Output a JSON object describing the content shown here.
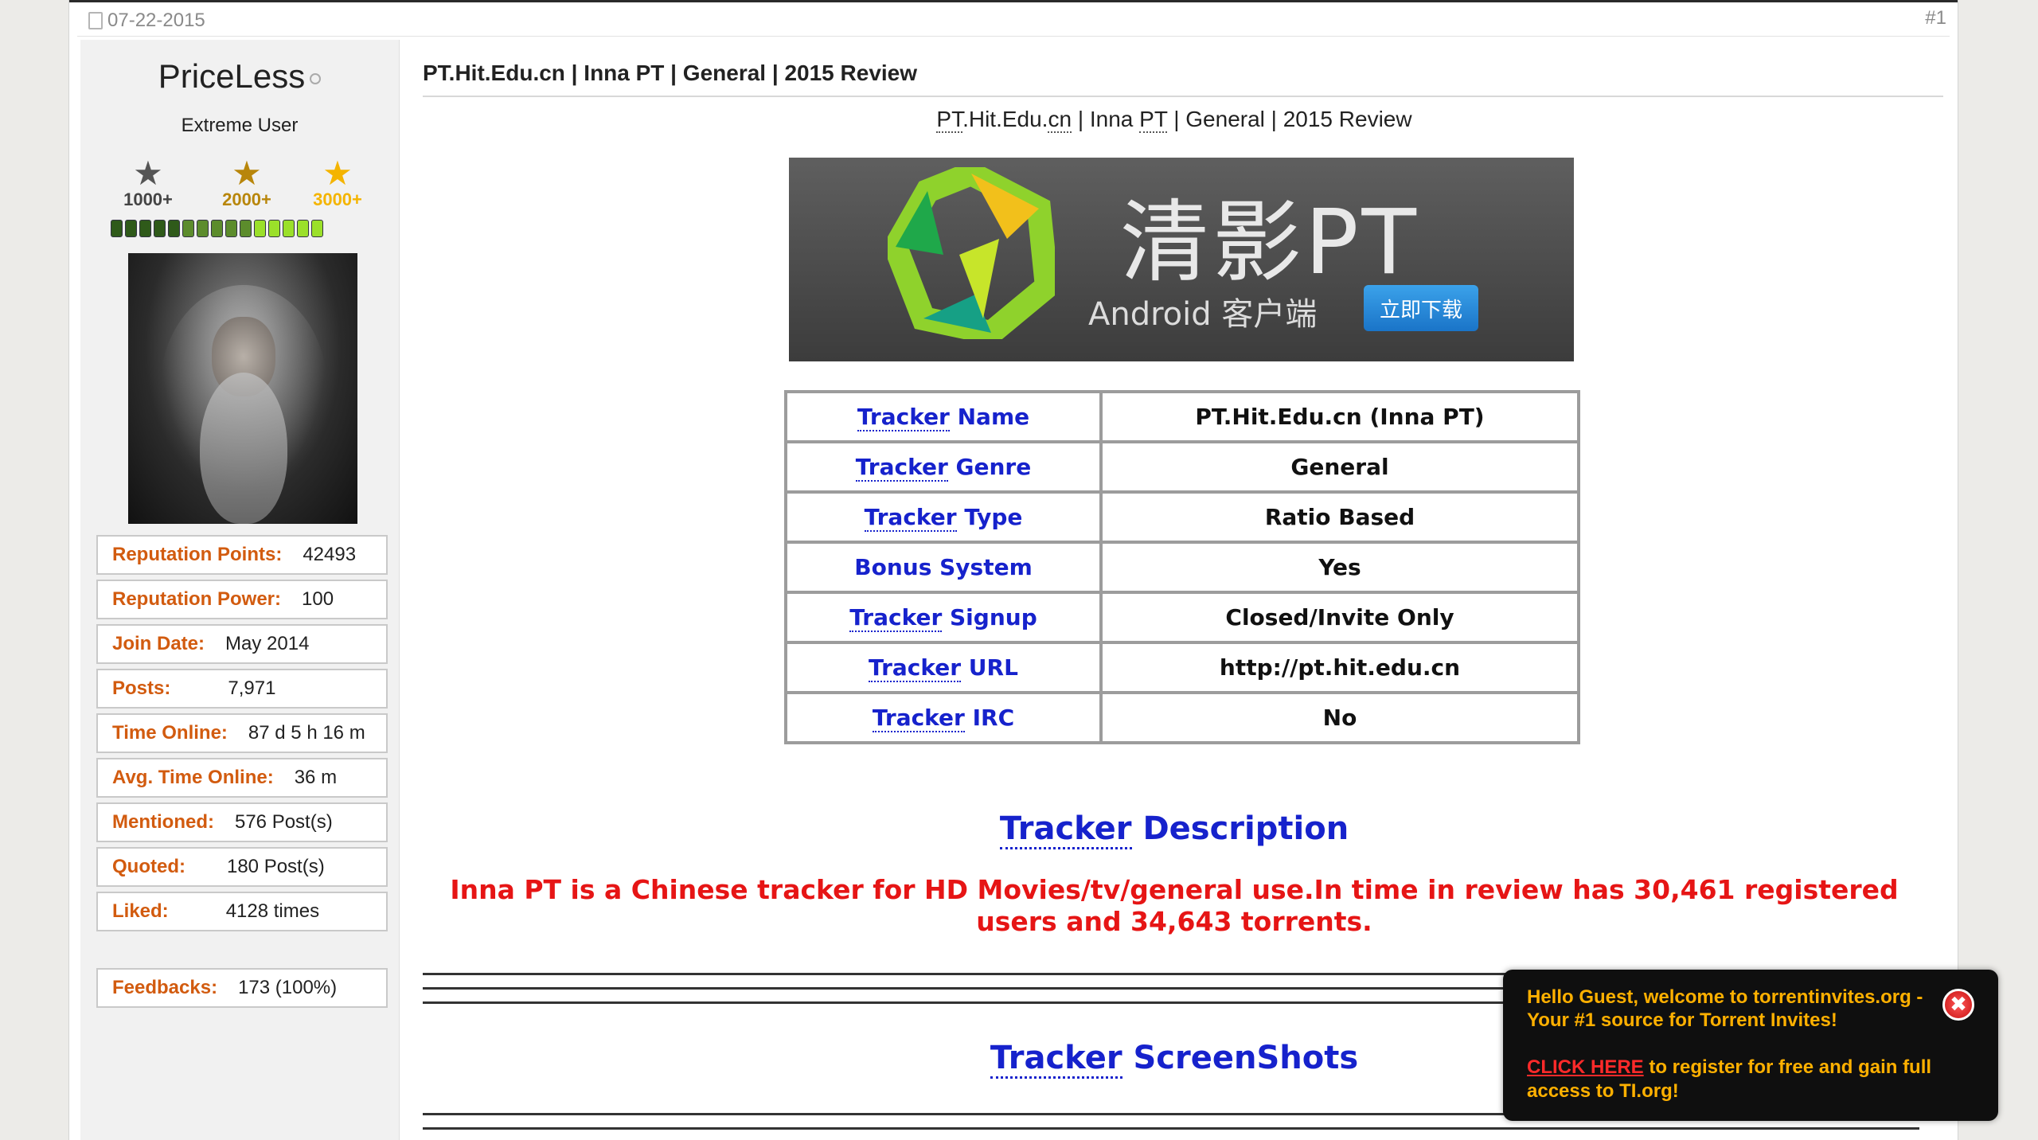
{
  "post": {
    "date": "07-22-2015",
    "number": "#1"
  },
  "user": {
    "name": "PriceLess",
    "title": "Extreme User",
    "awards": [
      {
        "label": "1000+",
        "color": "#555555"
      },
      {
        "label": "2000+",
        "color": "#b8860b"
      },
      {
        "label": "3000+",
        "color": "#f4b400"
      }
    ],
    "rep_segments": [
      "#2f5a1a",
      "#2f5a1a",
      "#2f5a1a",
      "#2f5a1a",
      "#2f5a1a",
      "#5c8c2c",
      "#5c8c2c",
      "#5c8c2c",
      "#5c8c2c",
      "#5c8c2c",
      "#9be02a",
      "#9be02a",
      "#9be02a",
      "#9be02a",
      "#9be02a"
    ],
    "stats": [
      {
        "label": "Reputation Points:",
        "value": "42493"
      },
      {
        "label": "Reputation Power:",
        "value": "100"
      },
      {
        "label": "Join Date:",
        "value": "May 2014"
      },
      {
        "label": "Posts:",
        "value": "7,971"
      },
      {
        "label": "Time Online:",
        "value": "87 d 5 h 16 m"
      },
      {
        "label": "Avg. Time Online:",
        "value": "36 m"
      },
      {
        "label": "Mentioned:",
        "value": "576 Post(s)"
      },
      {
        "label": "Quoted:",
        "value": "180 Post(s)"
      },
      {
        "label": "Liked:",
        "value": "4128 times"
      }
    ],
    "feedback": {
      "label": "Feedbacks:",
      "value": "173 (100%)"
    }
  },
  "content": {
    "title": "PT.Hit.Edu.cn | Inna PT | General | 2015 Review",
    "subtitle": {
      "a": "PT",
      "b": ".Hit.Edu.",
      "c": "cn",
      "d": " | Inna ",
      "e": "PT",
      "f": " | General | 2015 Review"
    },
    "banner": {
      "title": "清影PT",
      "sub": "Android 客户端",
      "button": "立即下载"
    },
    "table": [
      {
        "key_u": "Tracker",
        "key_rest": " Name",
        "value": "PT.Hit.Edu.cn (Inna PT)"
      },
      {
        "key_u": "Tracker",
        "key_rest": " Genre",
        "value": "General"
      },
      {
        "key_u": "Tracker",
        "key_rest": " Type",
        "value": "Ratio Based"
      },
      {
        "key_u": "",
        "key_rest": "Bonus System",
        "value": "Yes"
      },
      {
        "key_u": "Tracker",
        "key_rest": " Signup",
        "value": "Closed/Invite Only"
      },
      {
        "key_u": "Tracker",
        "key_rest": " URL",
        "value": "http://pt.hit.edu.cn"
      },
      {
        "key_u": "Tracker",
        "key_rest": " IRC",
        "value": "No"
      }
    ],
    "description_heading": {
      "u": "Tracker",
      "rest": " Description"
    },
    "description": "Inna PT is a Chinese tracker for HD Movies/tv/general use.In time in review has 30,461 registered users and 34,643 torrents.",
    "screenshots_heading": {
      "u": "Tracker",
      "rest": " ScreenShots"
    }
  },
  "popup": {
    "line1": "Hello Guest, welcome to torrentinvites.org - Your #1 source for Torrent Invites!",
    "cta": "CLICK HERE",
    "line2_rest": " to register for free and gain full access to TI.org!",
    "close_glyph": "✖"
  }
}
